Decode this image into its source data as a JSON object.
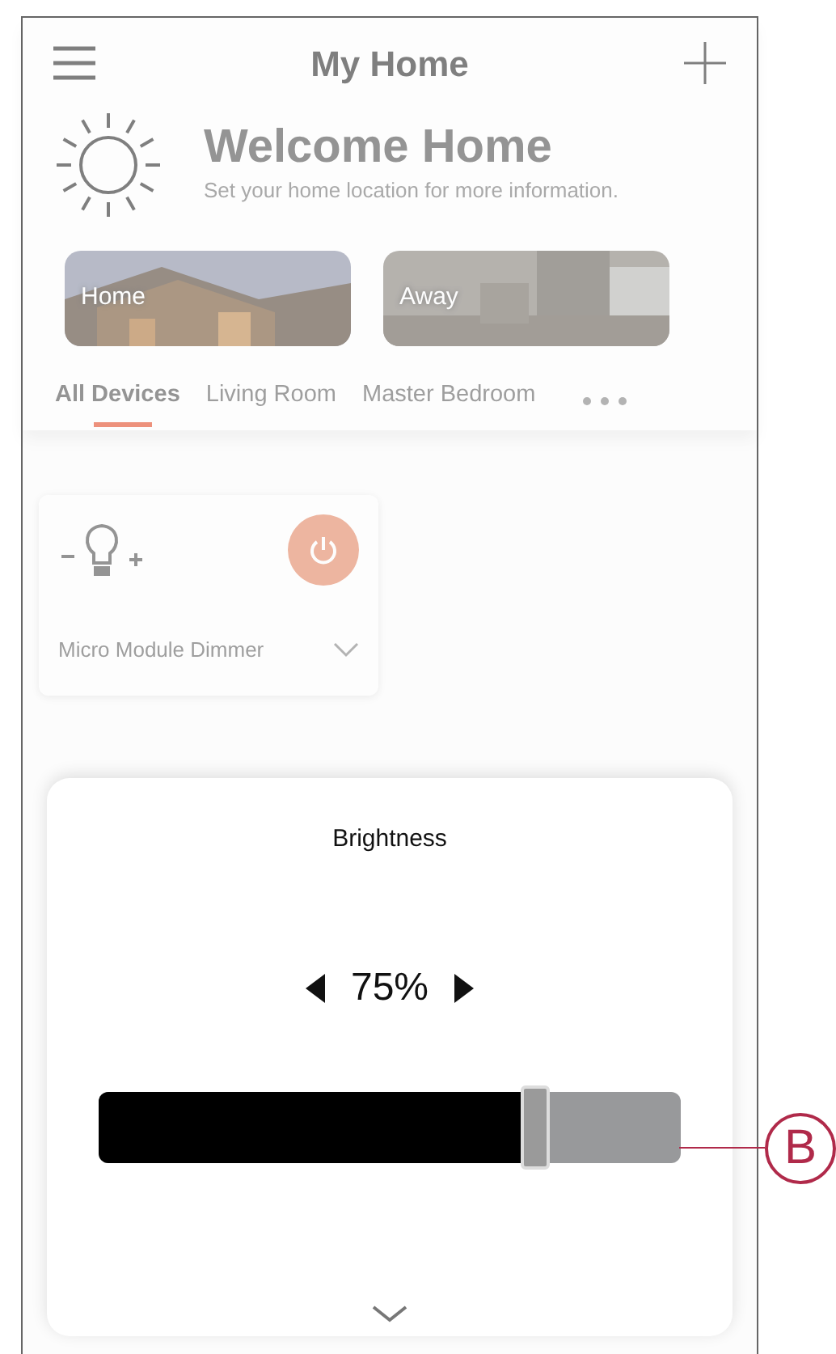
{
  "header": {
    "title": "My Home"
  },
  "welcome": {
    "title": "Welcome Home",
    "subtitle": "Set your home location for more information."
  },
  "modes": [
    {
      "label": "Home"
    },
    {
      "label": "Away"
    }
  ],
  "rooms": [
    {
      "label": "All Devices",
      "selected": true
    },
    {
      "label": "Living Room",
      "selected": false
    },
    {
      "label": "Master Bedroom",
      "selected": false
    }
  ],
  "devices": [
    {
      "name": "Micro Module Dimmer"
    }
  ],
  "brightness_sheet": {
    "title": "Brightness",
    "reading": "75%",
    "level": 0.75
  },
  "callout": {
    "label": "B"
  }
}
